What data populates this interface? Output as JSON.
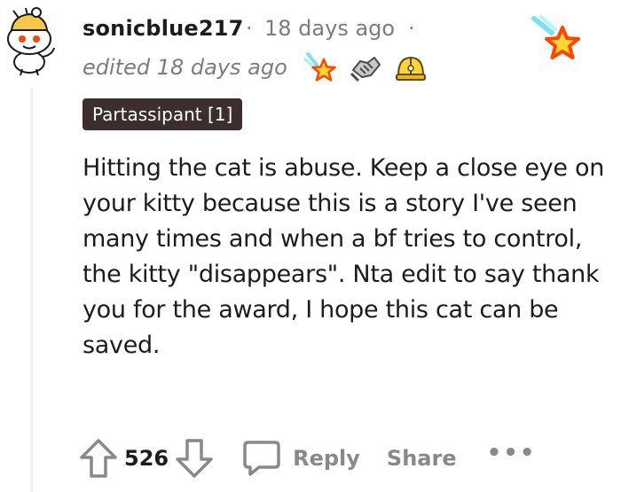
{
  "comment": {
    "username": "sonicblue217",
    "separator": "·",
    "timestamp": "18 days ago",
    "edited_label": "edited 18 days ago",
    "flair": "Partassipant [1]",
    "body": "Hitting the cat is abuse. Keep a close eye on your kitty because this is a story I've seen many times and when a bf tries to control, the kitty \"disappears\". Nta edit to say thank you for the award, I hope this cat can be saved.",
    "awards": [
      "rocket-star-award-icon",
      "handshake-award-icon",
      "helmet-award-icon"
    ],
    "featured_award": "shooting-star-award-icon"
  },
  "actions": {
    "vote_count": "526",
    "reply_label": "Reply",
    "share_label": "Share",
    "more_label": "•••"
  },
  "colors": {
    "text": "#1c1c1c",
    "meta": "#7c7c7c",
    "flair_bg": "#3d2e2e",
    "action_gray": "#878a8c"
  }
}
